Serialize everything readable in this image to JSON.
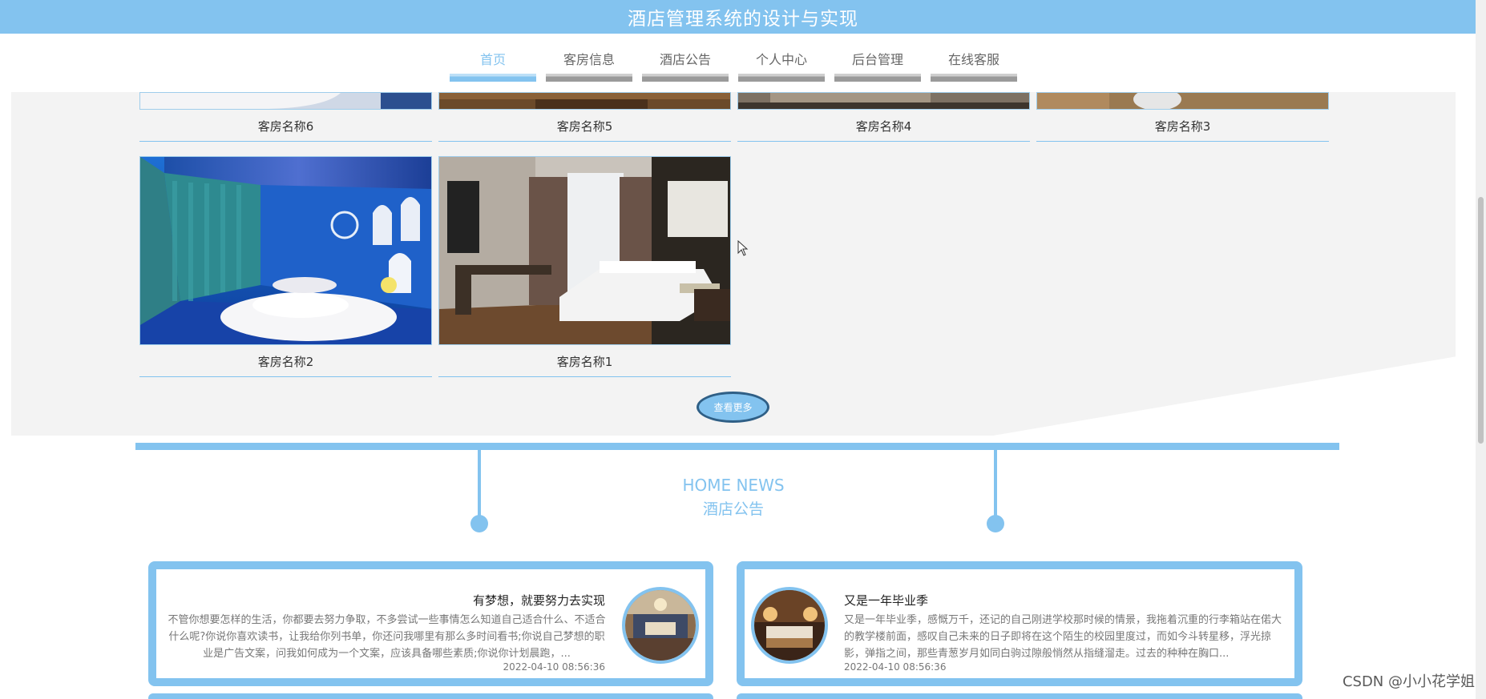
{
  "header": {
    "title": "酒店管理系统的设计与实现"
  },
  "nav": {
    "items": [
      {
        "label": "首页",
        "active": true
      },
      {
        "label": "客房信息"
      },
      {
        "label": "酒店公告"
      },
      {
        "label": "个人中心"
      },
      {
        "label": "后台管理"
      },
      {
        "label": "在线客服"
      }
    ]
  },
  "rooms": [
    {
      "name": "客房名称6"
    },
    {
      "name": "客房名称5"
    },
    {
      "name": "客房名称4"
    },
    {
      "name": "客房名称3"
    },
    {
      "name": "客房名称2"
    },
    {
      "name": "客房名称1"
    }
  ],
  "rooms_more_label": "查看更多",
  "news": {
    "title_en": "HOME NEWS",
    "title_cn": "酒店公告",
    "items": [
      {
        "title": "有梦想，就要努力去实现",
        "text": "不管你想要怎样的生活，你都要去努力争取，不多尝试一些事情怎么知道自己适合什么、不适合什么呢?你说你喜欢读书，让我给你列书单，你还问我哪里有那么多时间看书;你说自己梦想的职业是广告文案，问我如何成为一个文案，应该具备哪些素质;你说你计划晨跑，...",
        "date": "2022-04-10 08:56:36"
      },
      {
        "title": "又是一年毕业季",
        "text": "又是一年毕业季，感慨万千，还记的自己刚进学校那时候的情景，我拖着沉重的行李箱站在偌大的教学楼前面，感叹自己未来的日子即将在这个陌生的校园里度过，而如今斗转星移，浮光掠影，弹指之间，那些青葱岁月如同白驹过隙般悄然从指缝溜走。过去的种种在胸口...",
        "date": "2022-04-10 08:56:36"
      }
    ]
  },
  "watermark": "CSDN @小小花学姐",
  "colors": {
    "accent": "#83c3ef",
    "panel": "#f3f3f3"
  }
}
